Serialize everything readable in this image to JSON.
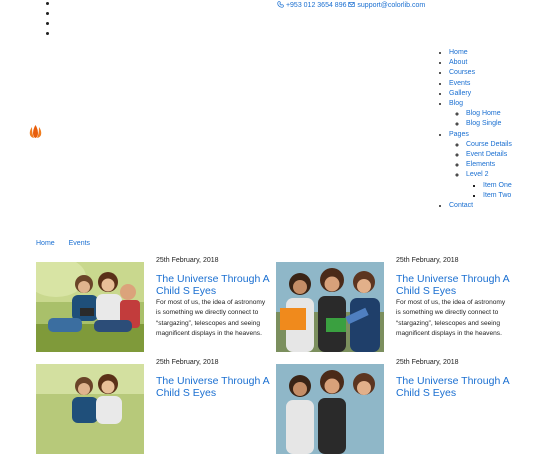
{
  "topbar": {
    "phone": "+953 012 3654 896",
    "email": "support@colorlib.com",
    "social_count": 4
  },
  "logo": {
    "icon": "flame-logo-icon",
    "color": "#e85d0c"
  },
  "nav": {
    "home": "Home",
    "about": "About",
    "courses": "Courses",
    "events": "Events",
    "gallery": "Gallery",
    "blog": "Blog",
    "blog_home": "Blog Home",
    "blog_single": "Blog Single",
    "pages": "Pages",
    "course_details": "Course Details",
    "event_details": "Event Details",
    "elements": "Elements",
    "level2": "Level 2",
    "item_one": "Item One",
    "item_two": "Item Two",
    "contact": "Contact"
  },
  "breadcrumb": {
    "home": "Home",
    "events": "Events"
  },
  "events": [
    {
      "date": "25th February, 2018",
      "title": "The Universe Through A Child S Eyes",
      "description": "For most of us, the idea of astronomy is something we directly connect to “stargazing”, telescopes and seeing magnificent displays in the heavens."
    },
    {
      "date": "25th February, 2018",
      "title": "The Universe Through A Child S Eyes",
      "description": "For most of us, the idea of astronomy is something we directly connect to “stargazing”, telescopes and seeing magnificent displays in the heavens."
    },
    {
      "date": "25th February, 2018",
      "title": "The Universe Through A Child S Eyes"
    },
    {
      "date": "25th February, 2018",
      "title": "The Universe Through A Child S Eyes"
    }
  ],
  "colors": {
    "link": "#1a6fd1",
    "text": "#222222"
  }
}
